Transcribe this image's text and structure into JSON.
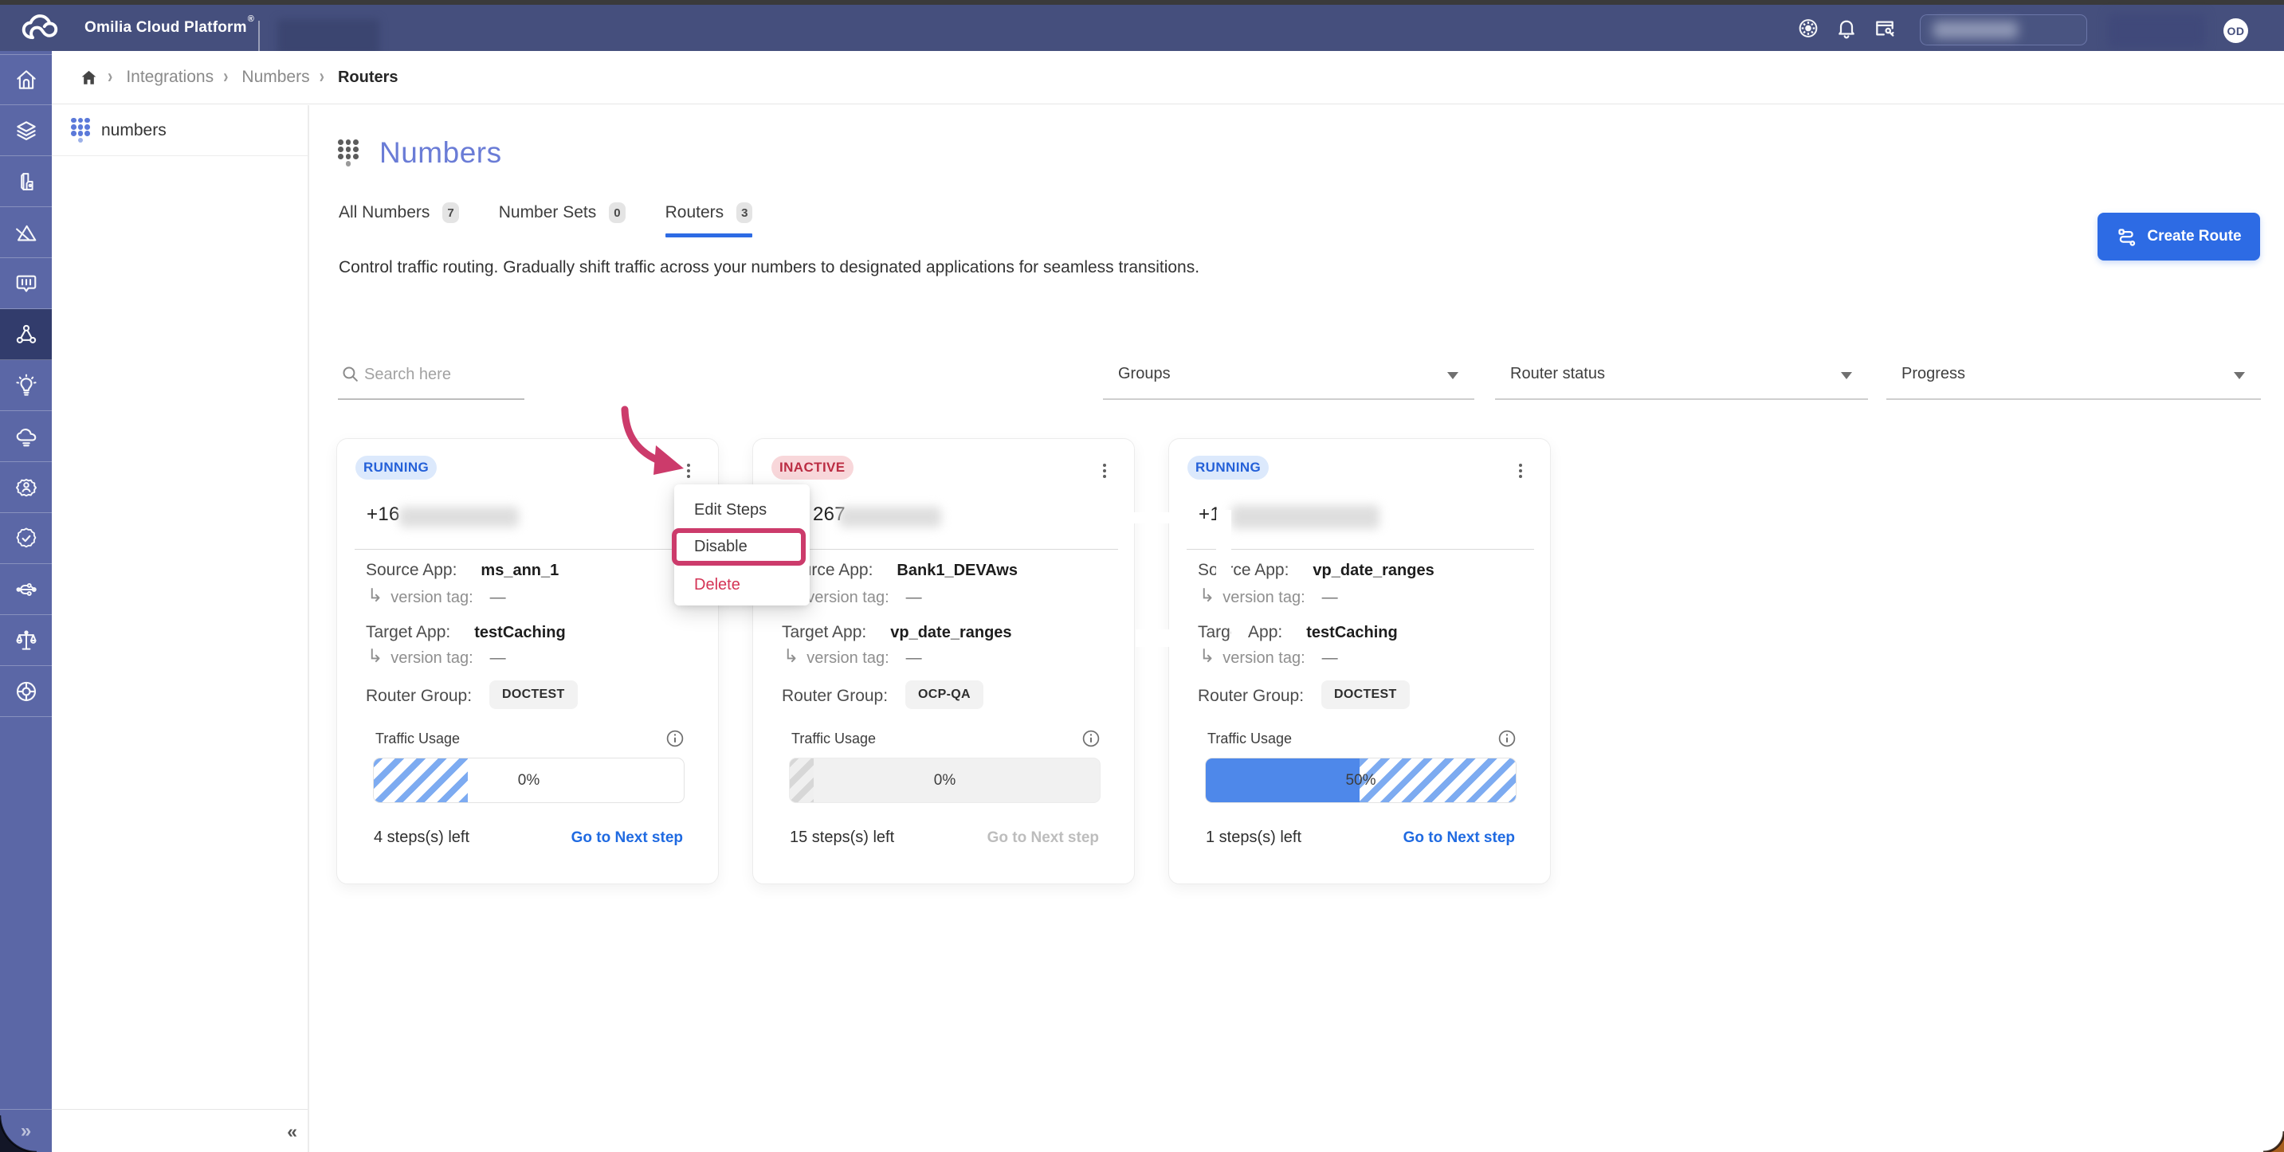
{
  "header": {
    "brand": "Omilia Cloud Platform",
    "registered_mark": "®",
    "avatar_initials": "OD",
    "icons": [
      "help-icon",
      "notifications-bell-icon",
      "api-key-card-icon"
    ]
  },
  "sidebar": {
    "items": [
      {
        "icon": "home-icon"
      },
      {
        "icon": "layers-icon"
      },
      {
        "icon": "phone-icon"
      },
      {
        "icon": "design-ruler-icon"
      },
      {
        "icon": "console-chat-icon"
      },
      {
        "icon": "integrations-molecule-icon",
        "active": true
      },
      {
        "icon": "insights-bulb-icon"
      },
      {
        "icon": "cloud-deploy-icon"
      },
      {
        "icon": "admin-gear-user-icon"
      },
      {
        "icon": "badge-check-icon"
      },
      {
        "icon": "pipeline-icon"
      },
      {
        "icon": "compliance-scales-icon"
      },
      {
        "icon": "support-lifebuoy-icon"
      }
    ],
    "expand_glyph": "»"
  },
  "subsidebar": {
    "item_label": "numbers",
    "collapse_glyph": "«"
  },
  "breadcrumb": {
    "items": [
      "Integrations",
      "Numbers",
      "Routers"
    ],
    "separator": "›"
  },
  "page": {
    "title": "Numbers",
    "description": "Control traffic routing. Gradually shift traffic across your numbers to designated applications for seamless transitions."
  },
  "tabs": [
    {
      "label": "All Numbers",
      "count": "7",
      "active": false
    },
    {
      "label": "Number Sets",
      "count": "0",
      "active": false
    },
    {
      "label": "Routers",
      "count": "3",
      "active": true
    }
  ],
  "actions": {
    "create_route": "Create Route"
  },
  "filters": {
    "search_placeholder": "Search here",
    "selects": [
      "Groups",
      "Router status",
      "Progress"
    ]
  },
  "card_labels": {
    "source": "Source App:",
    "target": "Target App:",
    "version_tag": "version tag:",
    "version_value": "—",
    "router_group": "Router Group:",
    "traffic": "Traffic Usage"
  },
  "cards": [
    {
      "status": "RUNNING",
      "number_visible": "+16",
      "source_app": "ms_ann_1",
      "target_app": "testCaching",
      "router_group": "DOCTEST",
      "progress_label": "0%",
      "progress_fill": "0%",
      "progress_planned": "30.4%",
      "steps_left": "4 steps(s) left",
      "next_step": "Go to Next step",
      "next_enabled": true
    },
    {
      "status": "INACTIVE",
      "number_visible": "267",
      "source_app": "Bank1_DEVAws",
      "target_app": "vp_date_ranges",
      "router_group": "OCP-QA",
      "progress_label": "0%",
      "progress_fill": "0%",
      "progress_planned": "7.7%",
      "steps_left": "15 steps(s) left",
      "next_step": "Go to Next step",
      "next_enabled": false
    },
    {
      "status": "RUNNING",
      "number_visible": "+1",
      "source_app": "vp_date_ranges",
      "target_app": "testCaching",
      "router_group": "DOCTEST",
      "progress_label": "50%",
      "progress_fill": "49.7%",
      "progress_planned": "50.3%",
      "steps_left": "1 steps(s) left",
      "next_step": "Go to Next step",
      "next_enabled": true
    }
  ],
  "context_menu": {
    "items": [
      "Edit Steps",
      "Disable",
      "Delete"
    ],
    "highlighted": "Disable"
  },
  "colors": {
    "header_bg": "#454f7d",
    "rail_bg": "#5b67a6",
    "rail_active_bg": "#323c6c",
    "accent_blue": "#2d6be4",
    "running_badge_bg": "#dce9fc",
    "running_badge_text": "#2460d8",
    "inactive_badge_bg": "#f8d7da",
    "inactive_badge_text": "#bb2d43",
    "delete_red": "#d43456",
    "annotation_pink": "#cc3b6b",
    "title_periwinkle": "#6a7cd6",
    "progress_fill_blue": "#4e88ea"
  }
}
